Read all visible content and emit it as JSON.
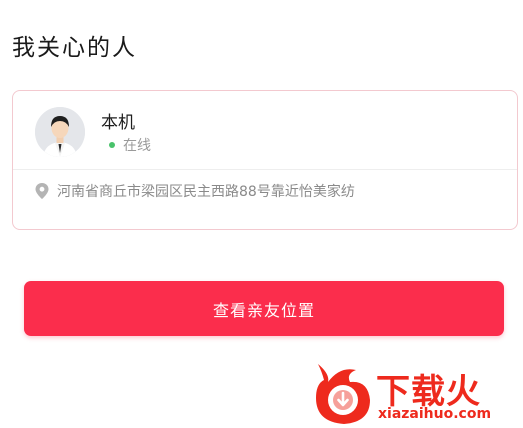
{
  "section": {
    "title": "我关心的人"
  },
  "device": {
    "name": "本机",
    "status": "在线",
    "location": "河南省商丘市梁园区民主西路88号靠近怡美家纺"
  },
  "actions": {
    "view_location_label": "查看亲友位置"
  },
  "watermark": {
    "title": "下载火",
    "url": "xiazaihuo.com"
  },
  "colors": {
    "accent": "#fb2d4c",
    "online": "#49c26b",
    "card_border": "#f3c9cf",
    "watermark": "#ee2a1d"
  },
  "icons": [
    "avatar-icon",
    "location-pin-icon"
  ]
}
